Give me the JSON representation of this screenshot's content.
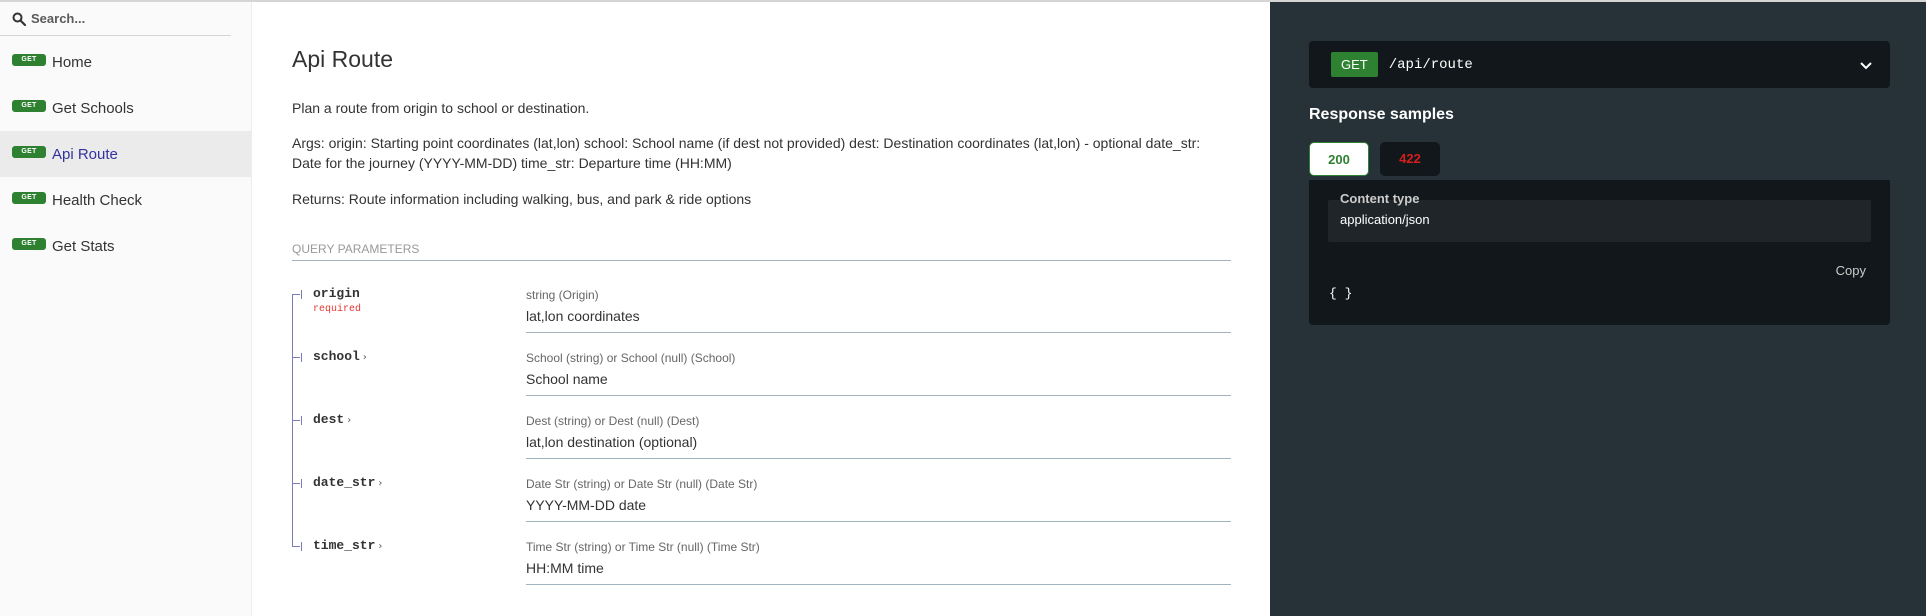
{
  "search": {
    "placeholder": "Search..."
  },
  "sidebar": {
    "items": [
      {
        "method": "GET",
        "label": "Home"
      },
      {
        "method": "GET",
        "label": "Get Schools"
      },
      {
        "method": "GET",
        "label": "Api Route"
      },
      {
        "method": "GET",
        "label": "Health Check"
      },
      {
        "method": "GET",
        "label": "Get Stats"
      }
    ],
    "active_index": 2
  },
  "main": {
    "title": "Api Route",
    "description": "Plan a route from origin to school or destination.",
    "args": "Args: origin: Starting point coordinates (lat,lon) school: School name (if dest not provided) dest: Destination coordinates (lat,lon) - optional date_str: Date for the journey (YYYY-MM-DD) time_str: Departure time (HH:MM)",
    "returns": "Returns: Route information including walking, bus, and park & ride options",
    "query_params_header": "QUERY PARAMETERS",
    "params": [
      {
        "name": "origin",
        "required": "required",
        "type": "string (Origin)",
        "description": "lat,lon coordinates"
      },
      {
        "name": "school",
        "type": "School (string) or School (null) (School)",
        "description": "School name"
      },
      {
        "name": "dest",
        "type": "Dest (string) or Dest (null) (Dest)",
        "description": "lat,lon destination (optional)"
      },
      {
        "name": "date_str",
        "type": "Date Str (string) or Date Str (null) (Date Str)",
        "description": "YYYY-MM-DD date"
      },
      {
        "name": "time_str",
        "type": "Time Str (string) or Time Str (null) (Time Str)",
        "description": "HH:MM time"
      }
    ]
  },
  "right_panel": {
    "endpoint": {
      "method": "GET",
      "path": "/api/route"
    },
    "response_samples_title": "Response samples",
    "tabs": [
      "200",
      "422"
    ],
    "active_tab": "200",
    "content_type_label": "Content type",
    "content_type_value": "application/json",
    "copy_label": "Copy",
    "sample_body": "{ }"
  },
  "colors": {
    "get_badge": "#2f8132",
    "active_nav_text": "#32329f",
    "right_panel_bg": "#263238",
    "error_tab_text": "#d41f1c",
    "required_text": "#e53935"
  }
}
